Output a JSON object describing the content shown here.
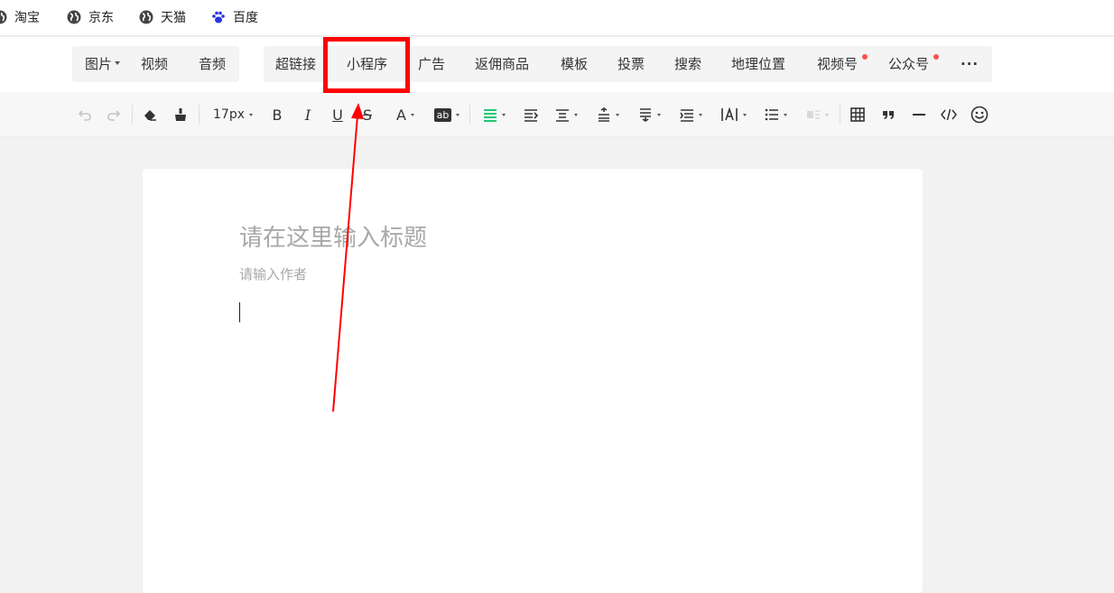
{
  "bookmarks": [
    "淘宝",
    "京东",
    "天猫",
    "百度"
  ],
  "insert_bar": {
    "group1": [
      "图片",
      "视频",
      "音频"
    ],
    "group2": [
      "超链接",
      "小程序",
      "广告",
      "返佣商品",
      "模板",
      "投票",
      "搜索",
      "地理位置",
      "视频号",
      "公众号"
    ],
    "more": "···"
  },
  "format_toolbar": {
    "font_size": "17px",
    "bold": "B",
    "italic": "I",
    "underline": "U",
    "strike": "S",
    "font_color": "A",
    "bg_color": "ab"
  },
  "editor": {
    "title_placeholder": "请在这里输入标题",
    "author_placeholder": "请输入作者"
  },
  "colors": {
    "accent_green": "#07c160",
    "annotation_red": "#ff0000",
    "notify_dot": "#fa5151"
  },
  "annotation": {
    "highlighted_item": "小程序"
  }
}
